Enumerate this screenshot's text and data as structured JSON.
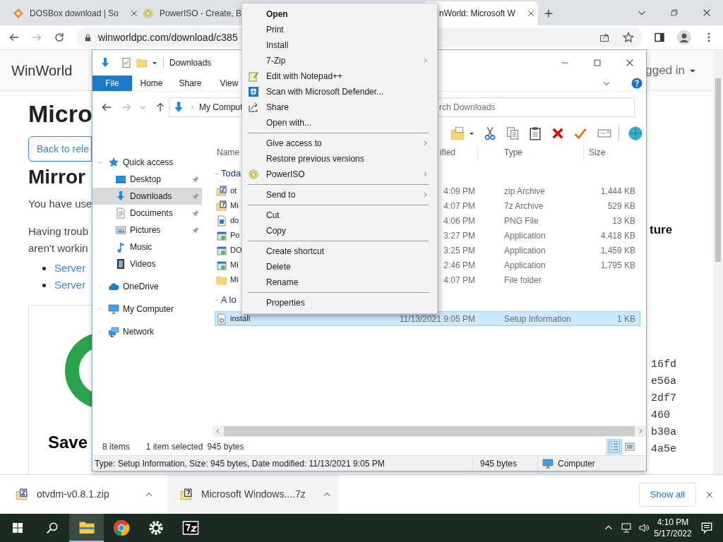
{
  "browser": {
    "tabs": [
      {
        "title": "DOSBox download | So",
        "selected": false
      },
      {
        "title": "PowerISO - Create, B",
        "selected": false
      },
      {
        "title": "nWorld: Microsoft W",
        "selected": true
      }
    ],
    "url": "winworldpc.com/download/c385",
    "page": {
      "site_name": "WinWorld",
      "login": "gged in",
      "heading": "Micro",
      "back_button": "Back to rele",
      "mirror_heading": "Mirror",
      "intro": "You have use",
      "trouble_lines": [
        "Having troub",
        "aren't workin"
      ],
      "server_links": [
        "Server",
        "Server"
      ],
      "side_heading": "ture",
      "hashes": [
        "16fd",
        "e56a",
        "2df7",
        "460",
        "b30a",
        "4a5e"
      ],
      "save_heading": "Save"
    },
    "downloads": [
      {
        "name": "otvdm-v0.8.1.zip",
        "kind": "zip",
        "highlighted": false
      },
      {
        "name": "Microsoft Windows....7z",
        "kind": "archive",
        "highlighted": true
      }
    ],
    "show_all": "Show all"
  },
  "explorer": {
    "title": "Downloads",
    "ribbon_tabs": [
      {
        "label": "File",
        "kind": "file"
      },
      {
        "label": "Home",
        "kind": "tab"
      },
      {
        "label": "Share",
        "kind": "tab"
      },
      {
        "label": "View",
        "kind": "tab"
      }
    ],
    "address": "My Comput",
    "search_placeholder": "rch Downloads",
    "columns": [
      "Name",
      "ified",
      "Type",
      "Size"
    ],
    "nav": [
      {
        "label": "Quick access",
        "kind": "quickaccess",
        "expanded": true,
        "selected": false,
        "children": [
          {
            "label": "Desktop",
            "kind": "desktop",
            "pinned": true,
            "selected": false
          },
          {
            "label": "Downloads",
            "kind": "downloads",
            "pinned": true,
            "selected": true
          },
          {
            "label": "Documents",
            "kind": "documents",
            "pinned": true,
            "selected": false
          },
          {
            "label": "Pictures",
            "kind": "pictures",
            "pinned": true,
            "selected": false
          },
          {
            "label": "Music",
            "kind": "music",
            "pinned": false,
            "selected": false
          },
          {
            "label": "Videos",
            "kind": "videos",
            "pinned": false,
            "selected": false
          }
        ]
      },
      {
        "label": "OneDrive",
        "kind": "cloud",
        "expanded": false,
        "selected": false
      },
      {
        "label": "My Computer",
        "kind": "computer",
        "expanded": false,
        "selected": false
      },
      {
        "label": "Network",
        "kind": "network",
        "expanded": false,
        "selected": false
      }
    ],
    "groups": [
      {
        "label": "Toda",
        "expanded": true,
        "rows": [
          {
            "name": "ot",
            "date": "4:09 PM",
            "type": "zip Archive",
            "size": "1,444 KB",
            "kind": "zip",
            "selected": false
          },
          {
            "name": "Mi",
            "date": "4:07 PM",
            "type": "7z Archive",
            "size": "529 KB",
            "kind": "archive",
            "selected": false
          },
          {
            "name": "do",
            "date": "4:06 PM",
            "type": "PNG File",
            "size": "13 KB",
            "kind": "image",
            "selected": false
          },
          {
            "name": "Po",
            "date": "3:27 PM",
            "type": "Application",
            "size": "4,418 KB",
            "kind": "application",
            "selected": false
          },
          {
            "name": "DO",
            "date": "3:25 PM",
            "type": "Application",
            "size": "1,459 KB",
            "kind": "application",
            "selected": false
          },
          {
            "name": "Mi",
            "date": "2:46 PM",
            "type": "Application",
            "size": "1,795 KB",
            "kind": "application",
            "selected": false
          },
          {
            "name": "Mi",
            "date": "4:07 PM",
            "type": "File folder",
            "kind": "folder",
            "selected": false
          }
        ]
      },
      {
        "label": "A lo",
        "expanded": true,
        "rows": [
          {
            "name": "install",
            "date": "11/13/2021 9:05 PM",
            "type": "Setup Information",
            "size": "1 KB",
            "kind": "setup",
            "selected": true
          }
        ]
      }
    ],
    "status": {
      "count": "8 items",
      "selection": "1 item selected",
      "size": "945 bytes"
    },
    "views": [
      {
        "kind": "details",
        "selected": true
      },
      {
        "kind": "large",
        "selected": false
      }
    ],
    "details": {
      "text": "Type: Setup Information, Size: 945 bytes, Date modified: 11/13/2021 9:05 PM",
      "size": "945 bytes",
      "location": "Computer"
    }
  },
  "context_menu": [
    {
      "kind": "item",
      "label": "Open",
      "bold": true,
      "submenu": false
    },
    {
      "kind": "item",
      "label": "Print",
      "bold": false,
      "submenu": false
    },
    {
      "kind": "item",
      "label": "Install",
      "bold": false,
      "submenu": false
    },
    {
      "kind": "item",
      "label": "7-Zip",
      "bold": false,
      "submenu": true
    },
    {
      "kind": "item",
      "label": "Edit with Notepad++",
      "bold": false,
      "submenu": false
    },
    {
      "kind": "item",
      "label": "Scan with Microsoft Defender...",
      "bold": false,
      "submenu": false
    },
    {
      "kind": "item",
      "label": "Share",
      "bold": false,
      "submenu": false
    },
    {
      "kind": "item",
      "label": "Open with...",
      "bold": false,
      "submenu": false
    },
    {
      "kind": "separator"
    },
    {
      "kind": "item",
      "label": "Give access to",
      "bold": false,
      "submenu": true
    },
    {
      "kind": "item",
      "label": "Restore previous versions",
      "bold": false,
      "submenu": false
    },
    {
      "kind": "item",
      "label": "PowerISO",
      "bold": false,
      "submenu": true
    },
    {
      "kind": "separator"
    },
    {
      "kind": "item",
      "label": "Send to",
      "bold": false,
      "submenu": true
    },
    {
      "kind": "separator"
    },
    {
      "kind": "item",
      "label": "Cut",
      "bold": false,
      "submenu": false
    },
    {
      "kind": "item",
      "label": "Copy",
      "bold": false,
      "submenu": false
    },
    {
      "kind": "separator"
    },
    {
      "kind": "item",
      "label": "Create shortcut",
      "bold": false,
      "submenu": false
    },
    {
      "kind": "item",
      "label": "Delete",
      "bold": false,
      "submenu": false
    },
    {
      "kind": "item",
      "label": "Rename",
      "bold": false,
      "submenu": false
    },
    {
      "kind": "separator"
    },
    {
      "kind": "item",
      "label": "Properties",
      "bold": false,
      "submenu": false
    }
  ],
  "taskbar": {
    "apps": [
      {
        "kind": "explorer",
        "active": true
      },
      {
        "kind": "browser",
        "active": false
      },
      {
        "kind": "settings",
        "active": false
      },
      {
        "kind": "archiver",
        "active": false
      }
    ],
    "time": "4:10 PM",
    "date": "5/17/2022"
  }
}
